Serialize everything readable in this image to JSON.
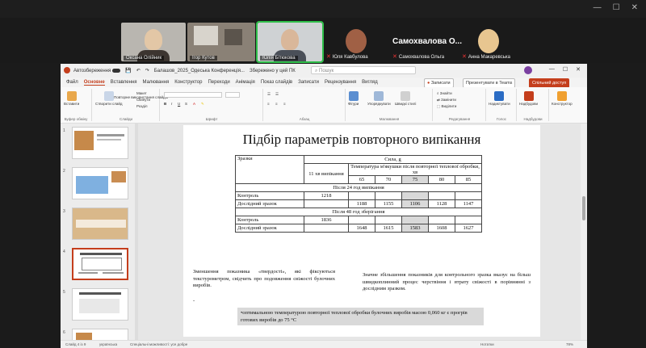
{
  "zoom": {
    "participants": [
      {
        "name": "Оксана Олійник",
        "muted": false
      },
      {
        "name": "Ігор Кутов",
        "muted": false
      },
      {
        "name": "Юлія Бітюкова",
        "muted": false,
        "active": true
      },
      {
        "name": "Юля Кавбулова",
        "muted": true
      },
      {
        "name": "Самохвалова Ольга",
        "muted": true,
        "display_name": "Самохвалова О..."
      },
      {
        "name": "Анна Макаревська",
        "muted": true
      }
    ]
  },
  "ppt": {
    "autosave_label": "Автозбереження",
    "file_title": "Балашов_2025_Одеська Конференція...",
    "save_status": "Збережено у цей ПК",
    "search_placeholder": "Пошук",
    "menu": [
      "Файл",
      "Основне",
      "Вставлення",
      "Малювання",
      "Конструктор",
      "Переходи",
      "Анімація",
      "Показ слайдів",
      "Записати",
      "Рецензування",
      "Вигляд"
    ],
    "menu_active_index": 1,
    "ribbon_right": {
      "record": "Записати",
      "present": "Презентувати в Teams",
      "share": "Спільний доступ"
    },
    "groups": [
      "Буфер обміну",
      "Слайди",
      "Шрифт",
      "Абзац",
      "Малювання",
      "Редагування",
      "Голос",
      "Надбудови"
    ],
    "ribbon_buttons": {
      "paste": "Вставити",
      "new_slide": "Створити слайд",
      "reuse": "Повторне використання слайдів",
      "layout": "Макет",
      "reset": "Скинути",
      "section": "Розділ",
      "shapes": "Фігури",
      "arrange": "Упорядкувати",
      "quick_styles": "Швидкі стилі",
      "find": "Знайти",
      "replace": "Замінити",
      "select": "Виділити",
      "dictate": "Надиктувати",
      "addins": "Надбудови",
      "designer": "Конструктор"
    }
  },
  "thumb_numbers": [
    "1",
    "2",
    "3",
    "4",
    "5",
    "6"
  ],
  "slide": {
    "title": "Підбір параметрів повторного випікання",
    "table": {
      "header_left": "Зразки",
      "header_force": "Сила, g",
      "col_11": "11 хв випікання",
      "col_temp": "Температура м'якушки після повторної теплової обробки, хв",
      "temps": [
        "65",
        "70",
        "75",
        "80",
        "85"
      ],
      "section1": "Після 24 год випікання",
      "section2": "Після 48 год зберігання",
      "rows1": [
        {
          "label": "Контроль",
          "v11": "1218",
          "vals": [
            "",
            "",
            "",
            "",
            ""
          ]
        },
        {
          "label": "Дослідний зразок",
          "v11": "",
          "vals": [
            "1188",
            "1155",
            "1106",
            "1128",
            "1147"
          ]
        }
      ],
      "rows2": [
        {
          "label": "Контроль",
          "v11": "1836",
          "vals": [
            "",
            "",
            "",
            "",
            ""
          ]
        },
        {
          "label": "Дослідний зразок",
          "v11": "",
          "vals": [
            "1648",
            "1615",
            "1583",
            "1608",
            "1627"
          ]
        }
      ]
    },
    "left_text": "Зменшення показника «твердості», які фіксуються текстурометром, свідчить про подовження свіжості булочних виробів.",
    "left_bullet": "-",
    "right_text": "Значне збільшення показників для контрольного зразка вказує на більш швидкоплинний процес черствіння і втрату свіжості в порівнянні з дослідним зразком.",
    "note": "•оптимальною температурою повторної теплової обробки булочних виробів масою 0,060 кг є прогрів готових виробів до 75 °С"
  },
  "status": {
    "slide_count": "Слайд 4 із 9",
    "language": "українська",
    "accessibility": "Спеціальні можливості: усе добре",
    "notes": "Нотатки",
    "zoom": "78%"
  },
  "colors": {
    "accent": "#c43e1c",
    "active_speaker": "#2fbf4a"
  }
}
